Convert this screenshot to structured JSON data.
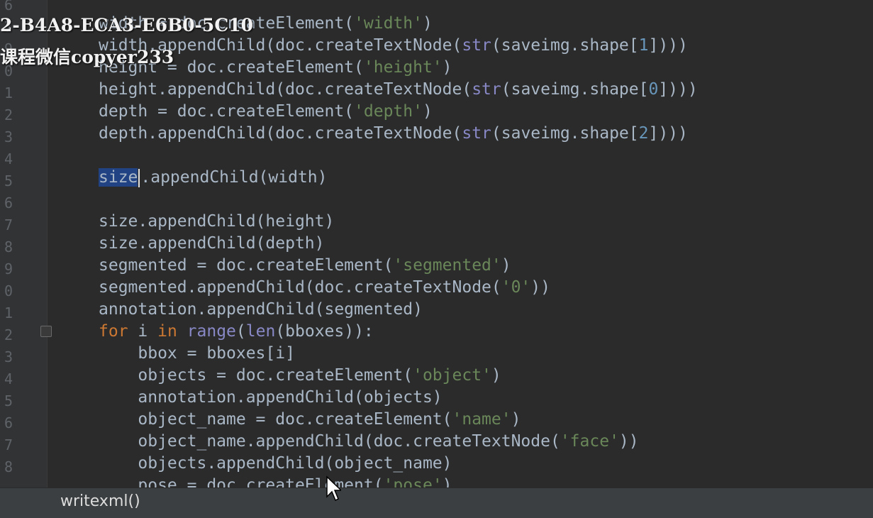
{
  "watermark": {
    "line1": "2-B4A8-ECA3-E6B0-5C10",
    "line2": "课程微信copyer233"
  },
  "gutter": {
    "line_numbers": [
      "6",
      "7",
      "9",
      "0",
      "1",
      "2",
      "3",
      "4",
      "5",
      "6",
      "7",
      "8",
      "9",
      "0",
      "1",
      "2",
      "3",
      "4",
      "5",
      "6",
      "7",
      "8"
    ]
  },
  "code_lines": [
    [
      {
        "t": "width",
        "c": "plain"
      },
      {
        "t": " = doc.",
        "c": "plain"
      },
      {
        "t": "createElement(",
        "c": "plain"
      },
      {
        "t": "'width'",
        "c": "str"
      },
      {
        "t": ")",
        "c": "plain"
      }
    ],
    [
      {
        "t": "width.appendChild(doc.createTextNode(",
        "c": "plain"
      },
      {
        "t": "str",
        "c": "builtin"
      },
      {
        "t": "(saveimg.shape[",
        "c": "plain"
      },
      {
        "t": "1",
        "c": "num"
      },
      {
        "t": "])))",
        "c": "plain"
      }
    ],
    [
      {
        "t": "height = doc.createElement(",
        "c": "plain"
      },
      {
        "t": "'height'",
        "c": "str"
      },
      {
        "t": ")",
        "c": "plain"
      }
    ],
    [
      {
        "t": "height.appendChild(doc.createTextNode(",
        "c": "plain"
      },
      {
        "t": "str",
        "c": "builtin"
      },
      {
        "t": "(saveimg.shape[",
        "c": "plain"
      },
      {
        "t": "0",
        "c": "num"
      },
      {
        "t": "])))",
        "c": "plain"
      }
    ],
    [
      {
        "t": "depth = doc.createElement(",
        "c": "plain"
      },
      {
        "t": "'depth'",
        "c": "str"
      },
      {
        "t": ")",
        "c": "plain"
      }
    ],
    [
      {
        "t": "depth.appendChild(doc.createTextNode(",
        "c": "plain"
      },
      {
        "t": "str",
        "c": "builtin"
      },
      {
        "t": "(saveimg.shape[",
        "c": "plain"
      },
      {
        "t": "2",
        "c": "num"
      },
      {
        "t": "])))",
        "c": "plain"
      }
    ],
    [],
    [
      {
        "t": "size",
        "c": "sel"
      },
      {
        "t": "|",
        "c": "caret"
      },
      {
        "t": ".appendChild(width)",
        "c": "plain"
      }
    ],
    [],
    [
      {
        "t": "size.appendChild(height)",
        "c": "plain"
      }
    ],
    [
      {
        "t": "size.appendChild(depth)",
        "c": "plain"
      }
    ],
    [
      {
        "t": "segmented = doc.createElement(",
        "c": "plain"
      },
      {
        "t": "'segmented'",
        "c": "str"
      },
      {
        "t": ")",
        "c": "plain"
      }
    ],
    [
      {
        "t": "segmented.appendChild(doc.createTextNode(",
        "c": "plain"
      },
      {
        "t": "'0'",
        "c": "str"
      },
      {
        "t": "))",
        "c": "plain"
      }
    ],
    [
      {
        "t": "annotation.appendChild(segmented)",
        "c": "plain"
      }
    ],
    [
      {
        "t": "for",
        "c": "kw"
      },
      {
        "t": " i ",
        "c": "plain"
      },
      {
        "t": "in",
        "c": "kw"
      },
      {
        "t": " ",
        "c": "plain"
      },
      {
        "t": "range",
        "c": "builtin"
      },
      {
        "t": "(",
        "c": "plain"
      },
      {
        "t": "len",
        "c": "builtin"
      },
      {
        "t": "(bboxes)):",
        "c": "plain"
      }
    ],
    [
      {
        "t": "    bbox = bboxes[i]",
        "c": "plain"
      }
    ],
    [
      {
        "t": "    objects = doc.createElement(",
        "c": "plain"
      },
      {
        "t": "'object'",
        "c": "str"
      },
      {
        "t": ")",
        "c": "plain"
      }
    ],
    [
      {
        "t": "    annotation.appendChild(objects)",
        "c": "plain"
      }
    ],
    [
      {
        "t": "    object_name = doc.createElement(",
        "c": "plain"
      },
      {
        "t": "'name'",
        "c": "str"
      },
      {
        "t": ")",
        "c": "plain"
      }
    ],
    [
      {
        "t": "    object_name.appendChild(doc.createTextNode(",
        "c": "plain"
      },
      {
        "t": "'face'",
        "c": "str"
      },
      {
        "t": "))",
        "c": "plain"
      }
    ],
    [
      {
        "t": "    objects.appendChild(object_name)",
        "c": "plain"
      }
    ],
    [
      {
        "t": "    pose = doc.createElement(",
        "c": "plain"
      },
      {
        "t": "'pose'",
        "c": "str"
      },
      {
        "t": ")",
        "c": "plain"
      }
    ]
  ],
  "statusbar": {
    "hint": "writexml()"
  },
  "colors": {
    "background": "#2b2b2b",
    "gutter": "#313335",
    "plain": "#a9b7c6",
    "string": "#6a8759",
    "number": "#6897bb",
    "keyword": "#cc7832",
    "builtin": "#8888c6",
    "selection": "#214283",
    "statusbar": "#3c3f41"
  },
  "icons": {
    "fold": "fold-marker-icon",
    "pointer": "mouse-pointer-icon"
  }
}
